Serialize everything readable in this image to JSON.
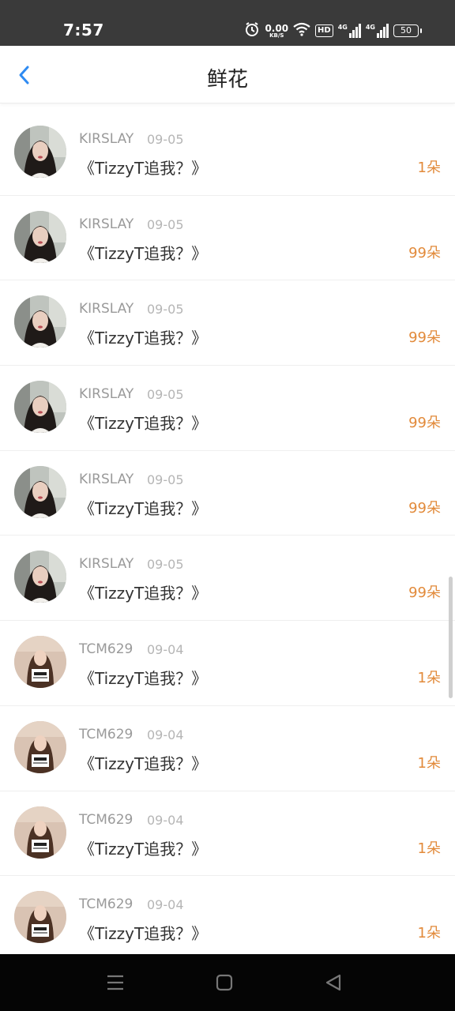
{
  "status_bar": {
    "time": "7:57",
    "net_speed_value": "0.00",
    "net_speed_unit": "KB/S",
    "hd_badge": "HD",
    "network_1": "4G",
    "network_2": "4G",
    "battery": "50"
  },
  "header": {
    "title": "鲜花",
    "back_icon": "chevron-left-icon"
  },
  "rows": [
    {
      "name": "KIRSLAY",
      "date": "09-05",
      "title": "《TizzyT追我？》",
      "amount": "1朵",
      "avatar": "avatar-a"
    },
    {
      "name": "KIRSLAY",
      "date": "09-05",
      "title": "《TizzyT追我？》",
      "amount": "99朵",
      "avatar": "avatar-a"
    },
    {
      "name": "KIRSLAY",
      "date": "09-05",
      "title": "《TizzyT追我？》",
      "amount": "99朵",
      "avatar": "avatar-a"
    },
    {
      "name": "KIRSLAY",
      "date": "09-05",
      "title": "《TizzyT追我？》",
      "amount": "99朵",
      "avatar": "avatar-a"
    },
    {
      "name": "KIRSLAY",
      "date": "09-05",
      "title": "《TizzyT追我？》",
      "amount": "99朵",
      "avatar": "avatar-a"
    },
    {
      "name": "KIRSLAY",
      "date": "09-05",
      "title": "《TizzyT追我？》",
      "amount": "99朵",
      "avatar": "avatar-a"
    },
    {
      "name": "TCM629",
      "date": "09-04",
      "title": "《TizzyT追我？》",
      "amount": "1朵",
      "avatar": "avatar-b"
    },
    {
      "name": "TCM629",
      "date": "09-04",
      "title": "《TizzyT追我？》",
      "amount": "1朵",
      "avatar": "avatar-b"
    },
    {
      "name": "TCM629",
      "date": "09-04",
      "title": "《TizzyT追我？》",
      "amount": "1朵",
      "avatar": "avatar-b"
    },
    {
      "name": "TCM629",
      "date": "09-04",
      "title": "《TizzyT追我？》",
      "amount": "1朵",
      "avatar": "avatar-b"
    }
  ],
  "colors": {
    "accent": "#2f8bf2",
    "amount": "#e28a3a",
    "status_bar": "#3a3a3a",
    "nav_bar": "#050505"
  },
  "nav": {
    "menu_icon": "menu-icon",
    "home_icon": "home-square-icon",
    "back_icon": "back-triangle-icon"
  }
}
